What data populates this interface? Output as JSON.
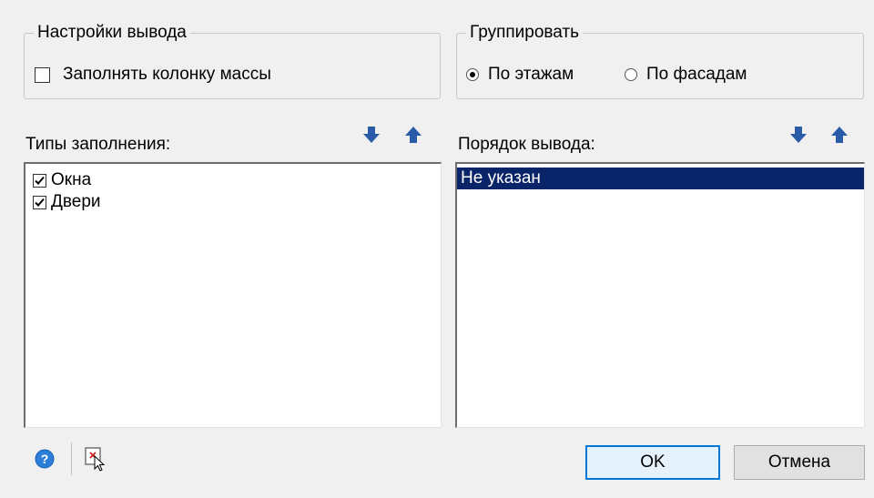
{
  "output_settings": {
    "title": "Настройки вывода",
    "fill_mass_column": {
      "label": "Заполнять колонку массы",
      "checked": false
    }
  },
  "group_by": {
    "title": "Группировать",
    "options": [
      {
        "label": "По этажам",
        "selected": true
      },
      {
        "label": "По фасадам",
        "selected": false
      }
    ]
  },
  "fill_types": {
    "label": "Типы заполнения:",
    "items": [
      {
        "label": "Окна",
        "checked": true
      },
      {
        "label": "Двери",
        "checked": true
      }
    ]
  },
  "output_order": {
    "label": "Порядок вывода:",
    "items": [
      {
        "label": "Не указан",
        "selected": true
      }
    ]
  },
  "icons": {
    "move_down": "arrow-down-icon",
    "move_up": "arrow-up-icon",
    "help": "help-icon",
    "reset": "reset-icon"
  },
  "colors": {
    "selection": "#0a246a",
    "arrow": "#2a5ba8",
    "help": "#2b7fd9"
  },
  "buttons": {
    "ok": "OK",
    "cancel": "Отмена"
  }
}
